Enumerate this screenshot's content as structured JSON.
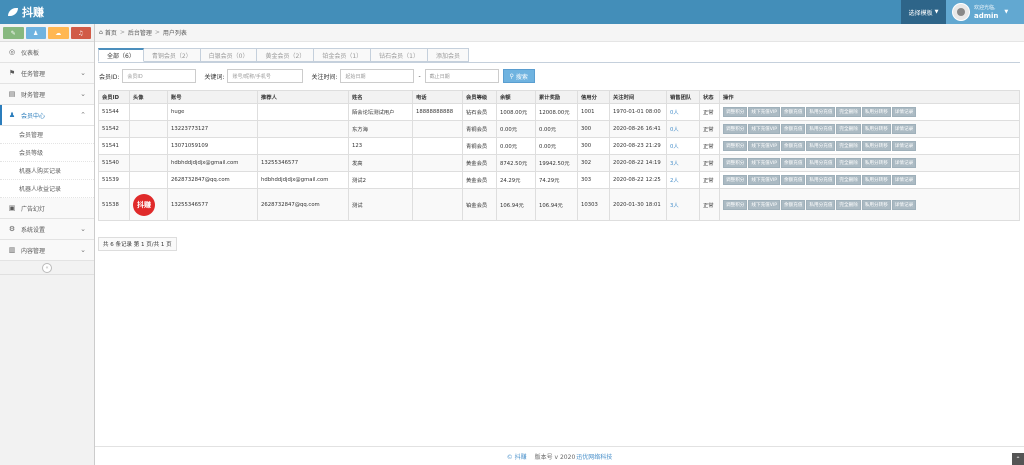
{
  "app": {
    "title": "抖赚"
  },
  "topbar": {
    "theme_label": "选择模板",
    "user_greeting": "欢迎光临,",
    "user_name": "admin"
  },
  "shortcuts": [
    {
      "icon": "pencil-icon",
      "color": "#87b87f",
      "glyph": "✎"
    },
    {
      "icon": "users-icon",
      "color": "#6fb3e0",
      "glyph": "♟"
    },
    {
      "icon": "cloud-icon",
      "color": "#ffb752",
      "glyph": "☁"
    },
    {
      "icon": "bell-icon",
      "color": "#d15b47",
      "glyph": "🔔"
    }
  ],
  "sidebar": {
    "items": [
      {
        "label": "仪表板",
        "icon": "dashboard-icon",
        "glyph": "◎"
      },
      {
        "label": "任务管理",
        "icon": "flag-icon",
        "glyph": "⚑"
      },
      {
        "label": "财务管理",
        "icon": "printer-icon",
        "glyph": "▤"
      },
      {
        "label": "会员中心",
        "icon": "user-icon",
        "glyph": "♟"
      },
      {
        "label": "会员管理"
      },
      {
        "label": "会员等级"
      },
      {
        "label": "机器人购买记录"
      },
      {
        "label": "机器人收益记录"
      },
      {
        "label": "广告幻灯",
        "icon": "image-icon",
        "glyph": "▣"
      },
      {
        "label": "系统设置",
        "icon": "gear-icon",
        "glyph": "⚙"
      },
      {
        "label": "内容管理",
        "icon": "book-icon",
        "glyph": "▥"
      }
    ]
  },
  "breadcrumb": {
    "home": "首页",
    "section": "后台管理",
    "page": "用户列表"
  },
  "tabs": [
    "全部（6）",
    "青铜会员（2）",
    "白银会员（0）",
    "黄金会员（2）",
    "铂金会员（1）",
    "钻石会员（1）",
    "添加会员"
  ],
  "filter": {
    "member_id_label": "会员ID:",
    "member_id_placeholder": "会员ID",
    "keyword_label": "关键词:",
    "keyword_placeholder": "账号/昵称/手机号",
    "time_label": "关注时间:",
    "start_placeholder": "起始日期",
    "dash": "-",
    "end_placeholder": "截止日期",
    "search_label": "搜索"
  },
  "table": {
    "headers": [
      "会员ID",
      "头像",
      "账号",
      "推荐人",
      "姓名",
      "电话",
      "会员等级",
      "余额",
      "累计奖励",
      "信用分",
      "关注时间",
      "销售团队",
      "状态",
      "操作"
    ],
    "rows": [
      {
        "id": "51544",
        "account": "huge",
        "referrer": "",
        "name": "陌会论坛测试用户",
        "phone": "18888888888",
        "level": "钻石会员",
        "balance": "1008.00元",
        "reward": "12008.00元",
        "credit": "1001",
        "time": "1970-01-01 08:00",
        "team": "0人",
        "status": "正常"
      },
      {
        "id": "51542",
        "account": "13223773127",
        "referrer": "",
        "name": "东方海",
        "phone": "",
        "level": "青铜会员",
        "balance": "0.00元",
        "reward": "0.00元",
        "credit": "300",
        "time": "2020-08-26 16:41",
        "team": "0人",
        "status": "正常"
      },
      {
        "id": "51541",
        "account": "13071059109",
        "referrer": "",
        "name": "123",
        "phone": "",
        "level": "青铜会员",
        "balance": "0.00元",
        "reward": "0.00元",
        "credit": "300",
        "time": "2020-08-23 21:29",
        "team": "0人",
        "status": "正常"
      },
      {
        "id": "51540",
        "account": "hdbhddjdjdjx@gmail.com",
        "referrer": "13255346577",
        "name": "发高",
        "phone": "",
        "level": "黄金会员",
        "balance": "8742.50元",
        "reward": "19942.50元",
        "credit": "302",
        "time": "2020-08-22 14:19",
        "team": "3人",
        "status": "正常"
      },
      {
        "id": "51539",
        "account": "2628732847@qq.com",
        "referrer": "hdbhddjdjdjx@gmail.com",
        "name": "测试2",
        "phone": "",
        "level": "黄金会员",
        "balance": "24.29元",
        "reward": "74.29元",
        "credit": "303",
        "time": "2020-08-22 12:25",
        "team": "2人",
        "status": "正常"
      },
      {
        "id": "51538",
        "account": "13255346577",
        "referrer": "2628732847@qq.com",
        "name": "测试",
        "phone": "",
        "level": "铂金会员",
        "balance": "106.94元",
        "reward": "106.94元",
        "credit": "10303",
        "time": "2020-01-30 18:01",
        "team": "3人",
        "status": "正常",
        "avatar_text": "抖赚"
      }
    ],
    "op_labels": [
      "调整积分",
      "线下充值VIP",
      "余额充值",
      "私用分充值",
      "完全删除",
      "私用分转移",
      "详情记录"
    ]
  },
  "pager": {
    "text": "共 6 条记录 第 1 页/共 1 页"
  },
  "footer": {
    "brand": "© 抖赚",
    "version": "版本号 v 2020",
    "company": "迅优网络科技"
  },
  "colors": {
    "topbar": "#438eb9",
    "accent": "#2b7dbc",
    "op_button": "#abbac3"
  }
}
